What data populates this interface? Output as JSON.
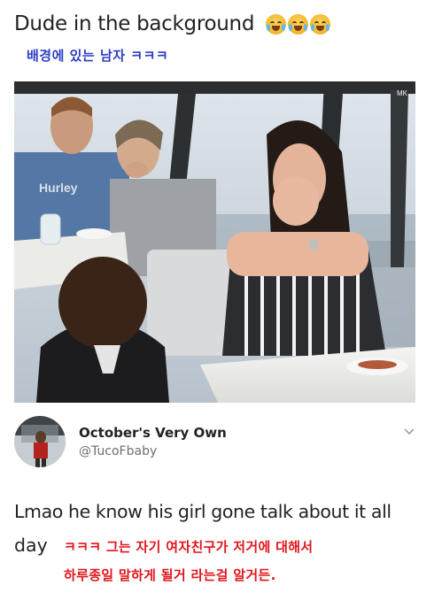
{
  "post": {
    "caption": "Dude in the background",
    "caption_emojis": [
      "crying-face-emoji",
      "crying-face-emoji",
      "crying-face-emoji"
    ],
    "caption_translation": "배경에 있는 남자 ㅋㅋㅋ"
  },
  "photo": {
    "watermark": "MK"
  },
  "tweet": {
    "author_name": "October's Very Own",
    "author_handle": "@TucoFbaby",
    "text_line_1": "Lmao he know his girl gone talk about it all",
    "text_line_2": "day",
    "translation_line_1": "ㅋㅋㅋ 그는 자기 여자친구가 저거에 대해서",
    "translation_line_2": "하루종일 말하게 될거 라는걸 알거든."
  },
  "colors": {
    "translation_blue": "#2d3fc4",
    "translation_red": "#e0151b"
  }
}
